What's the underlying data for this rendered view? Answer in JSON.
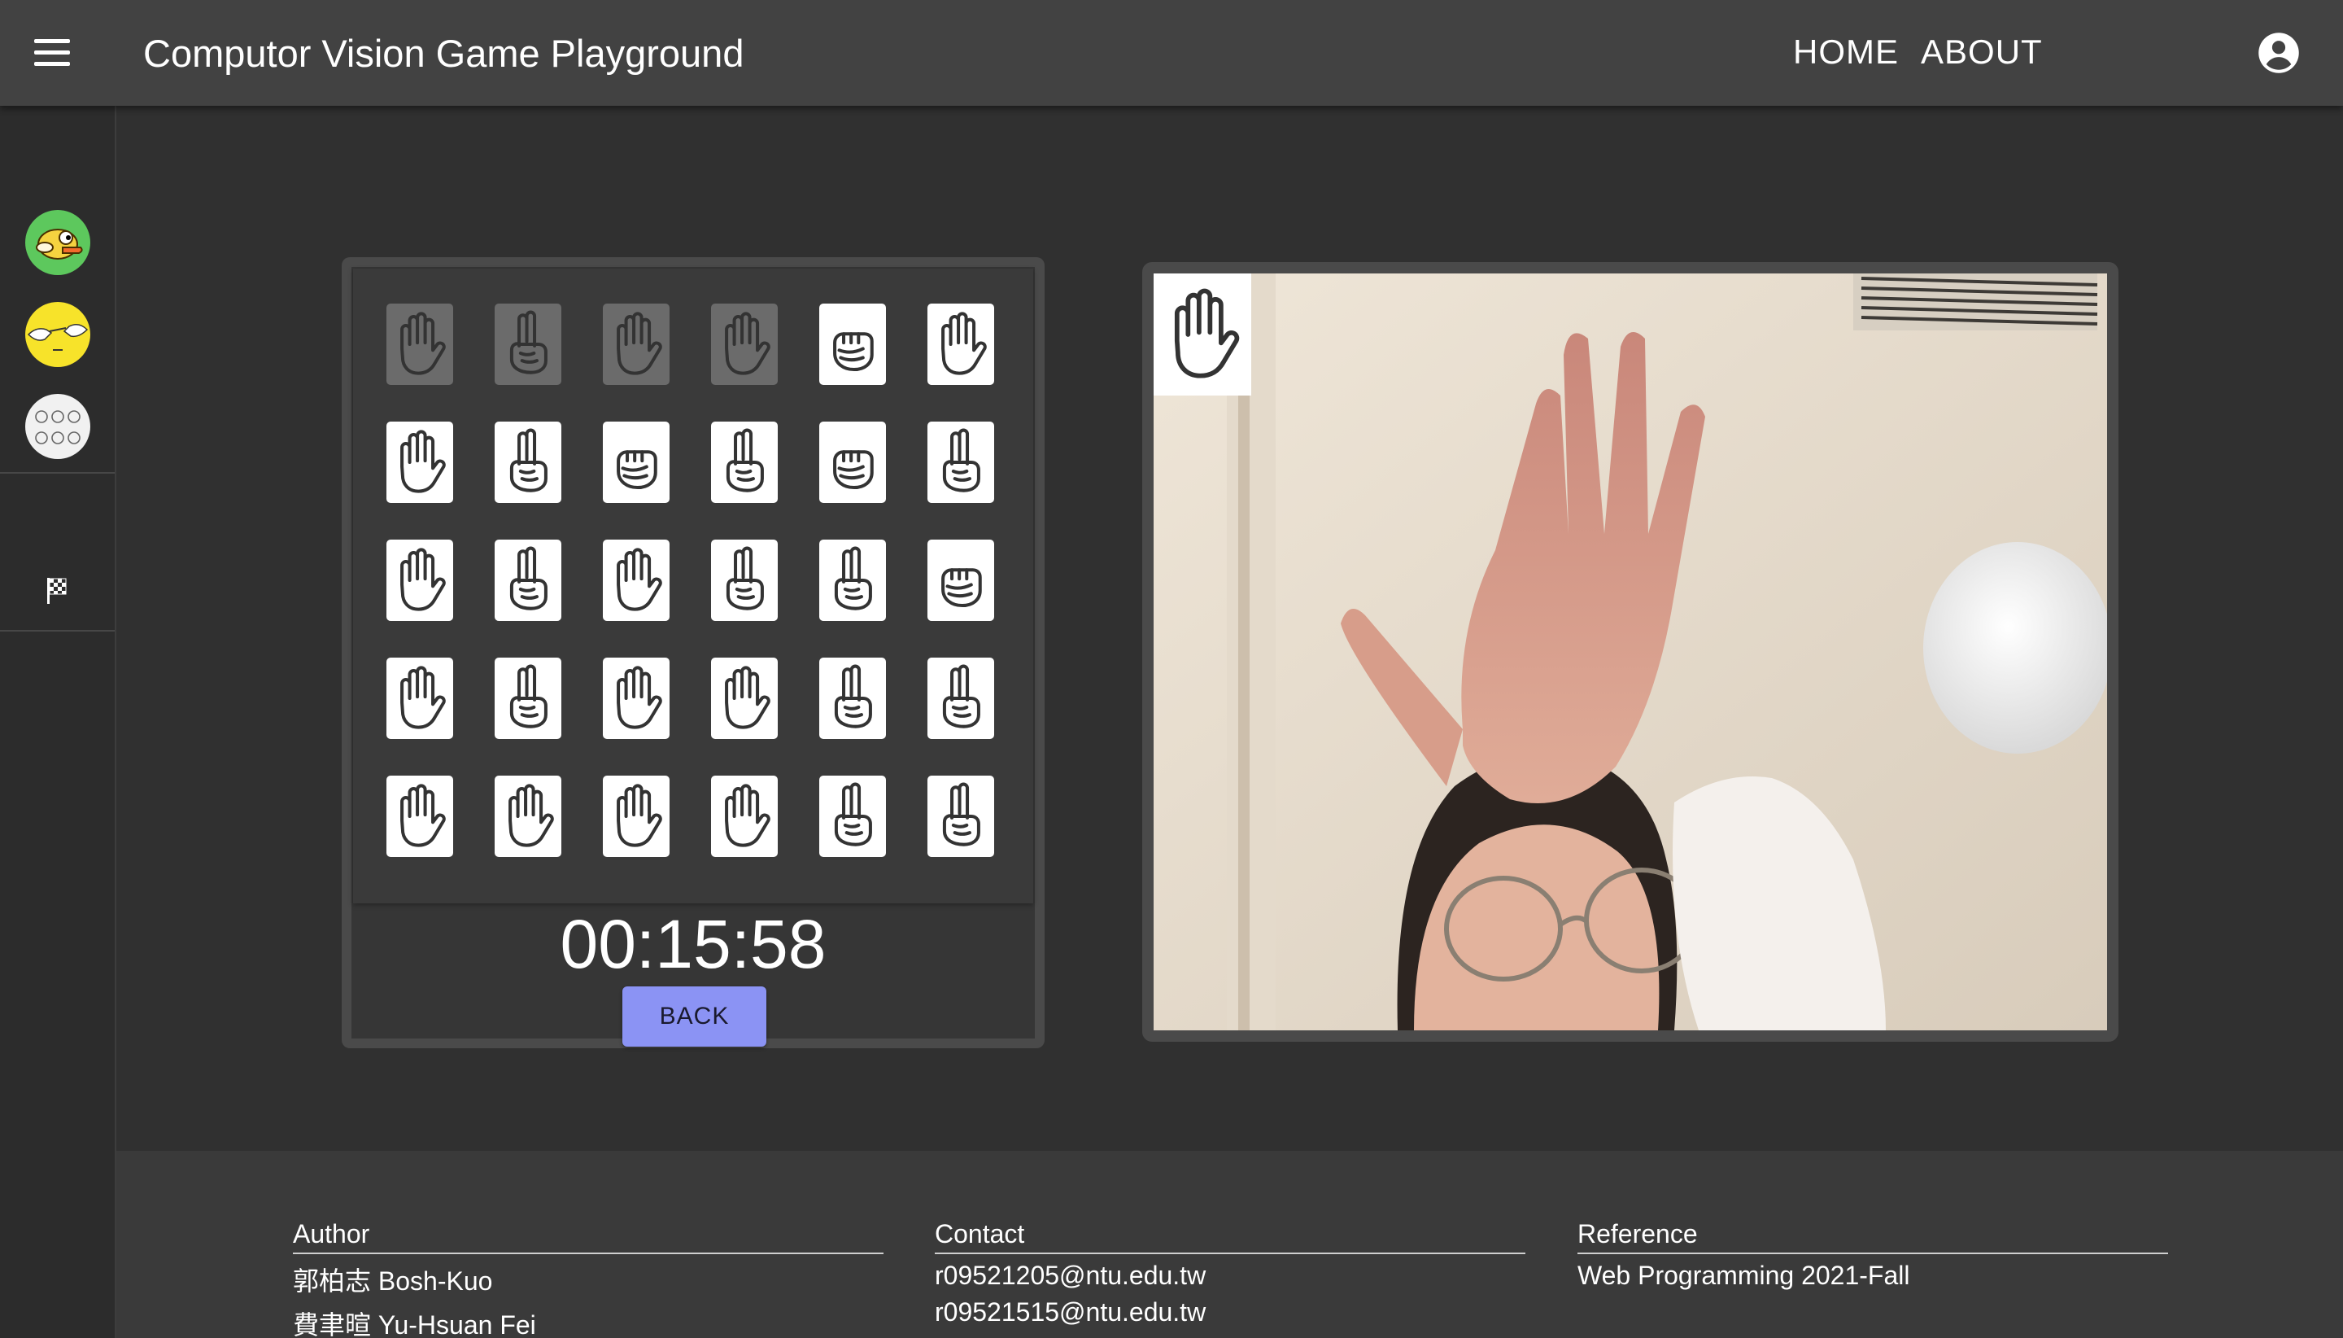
{
  "appbar": {
    "title": "Computor Vision Game Playground",
    "nav": {
      "home": "HOME",
      "about": "ABOUT"
    },
    "icons": {
      "menu": "menu-icon",
      "account": "account-circle-icon"
    }
  },
  "sidebar": {
    "games": [
      {
        "name": "flappy-bird",
        "icon": "flappy-bird-icon"
      },
      {
        "name": "hand-clap",
        "icon": "hand-clap-icon"
      },
      {
        "name": "rock-paper-scissors",
        "icon": "rock-paper-scissors-icon"
      }
    ],
    "leaderboard_icon": "checkered-flag-icon"
  },
  "board": {
    "rows": [
      [
        {
          "g": "paper",
          "done": true
        },
        {
          "g": "scissors",
          "done": true
        },
        {
          "g": "paper",
          "done": true
        },
        {
          "g": "paper",
          "done": true
        },
        {
          "g": "rock",
          "done": false
        },
        {
          "g": "paper",
          "done": false
        }
      ],
      [
        {
          "g": "paper",
          "done": false
        },
        {
          "g": "scissors",
          "done": false
        },
        {
          "g": "rock",
          "done": false
        },
        {
          "g": "scissors",
          "done": false
        },
        {
          "g": "rock",
          "done": false
        },
        {
          "g": "scissors",
          "done": false
        }
      ],
      [
        {
          "g": "paper",
          "done": false
        },
        {
          "g": "scissors",
          "done": false
        },
        {
          "g": "paper",
          "done": false
        },
        {
          "g": "scissors",
          "done": false
        },
        {
          "g": "scissors",
          "done": false
        },
        {
          "g": "rock",
          "done": false
        }
      ],
      [
        {
          "g": "paper",
          "done": false
        },
        {
          "g": "scissors",
          "done": false
        },
        {
          "g": "paper",
          "done": false
        },
        {
          "g": "paper",
          "done": false
        },
        {
          "g": "scissors",
          "done": false
        },
        {
          "g": "scissors",
          "done": false
        }
      ],
      [
        {
          "g": "paper",
          "done": false
        },
        {
          "g": "paper",
          "done": false
        },
        {
          "g": "paper",
          "done": false
        },
        {
          "g": "paper",
          "done": false
        },
        {
          "g": "scissors",
          "done": false
        },
        {
          "g": "scissors",
          "done": false
        }
      ]
    ],
    "timer": "00:15:58",
    "back_label": "BACK",
    "colors": {
      "done_card": "#6b6b6b",
      "card": "#ffffff",
      "back_button": "#8b93f4"
    }
  },
  "camera": {
    "detected_gesture": "paper",
    "detected_icon": "paper-hand-icon"
  },
  "footer": {
    "author": {
      "heading": "Author",
      "lines": [
        "郭柏志 Bosh-Kuo",
        "費聿暄 Yu-Hsuan Fei"
      ]
    },
    "contact": {
      "heading": "Contact",
      "lines": [
        "r09521205@ntu.edu.tw",
        "r09521515@ntu.edu.tw"
      ]
    },
    "reference": {
      "heading": "Reference",
      "lines": [
        "Web Programming 2021-Fall"
      ]
    }
  }
}
